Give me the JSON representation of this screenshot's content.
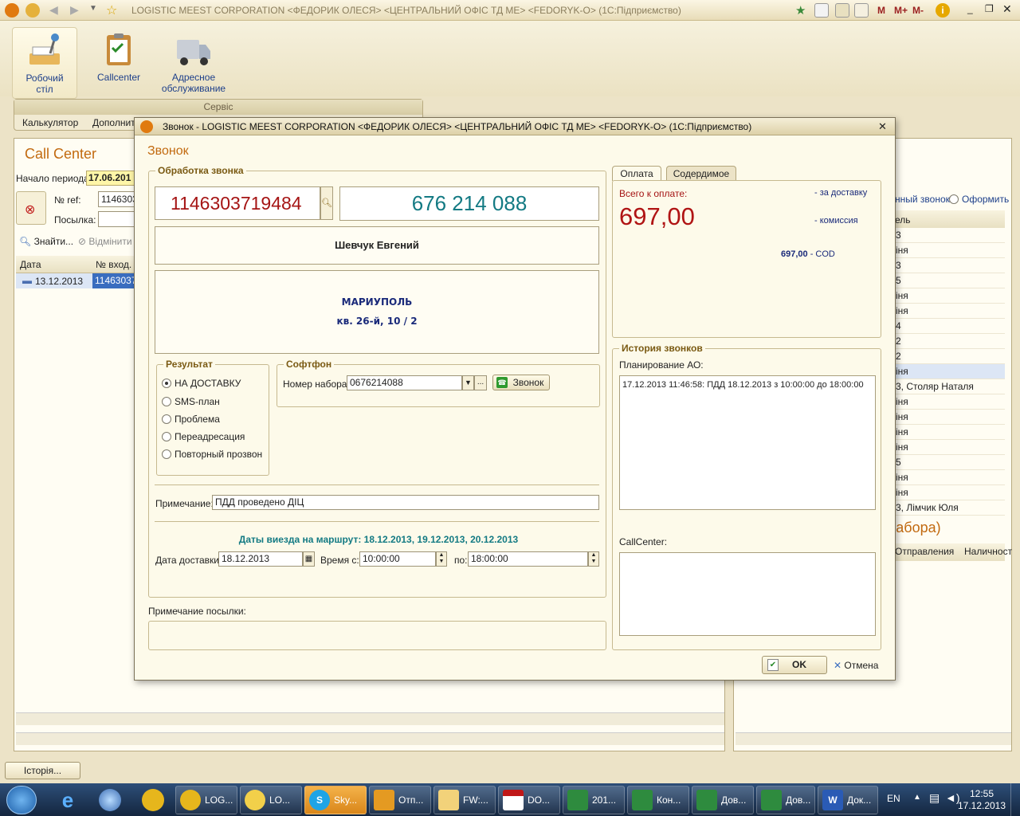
{
  "titlebar": {
    "title": "LOGISTIC MEEST CORPORATION    <ФЕДОРИК ОЛЕСЯ>  <ЦЕНТРАЛЬНИЙ ОФІС ТД МЕ>  <FEDORYK-O>  (1С:Підприємство)",
    "m": "M",
    "mplus": "M+",
    "mminus": "M-"
  },
  "toolbar": {
    "items": [
      {
        "label_line1": "Робочий",
        "label_line2": "стіл"
      },
      {
        "label_line1": "Callcenter",
        "label_line2": ""
      },
      {
        "label_line1": "Адресное",
        "label_line2": "обслуживание"
      }
    ],
    "service_header": "Сервіс",
    "service_items": [
      "Калькулятор",
      "Дополнитe"
    ]
  },
  "callcenter": {
    "title": "Call Center",
    "period_label": "Начало периода:",
    "period_value": "17.06.201",
    "ref_label": "№ ref:",
    "ref_value": "1146303",
    "parcel_label": "Посылка:",
    "find_label": "Знайти...",
    "cancel_label": "Відмінити",
    "columns": [
      "Дата",
      "№ вход."
    ],
    "row": {
      "date": "13.12.2013",
      "num": "11463037"
    }
  },
  "right_panel": {
    "radio_label": "нный звонок",
    "radio2_label": "Оформить",
    "col_header": "ель",
    "rows": [
      "3",
      "іня",
      "3",
      "5",
      "іня",
      "іня",
      "4",
      "2",
      "2",
      "іня",
      "3, Столяр Наталя",
      "іня",
      "іня",
      "іня",
      "іня",
      "5",
      "іня",
      "іня",
      "3, Лімчик Юля"
    ],
    "lower_title": "забора)",
    "lower_col1": "Отправления",
    "lower_col2": "Наличност"
  },
  "dialog": {
    "title": "Звонок - LOGISTIC MEEST CORPORATION    <ФЕДОРИК ОЛЕСЯ>  <ЦЕНТРАЛЬНИЙ ОФІС ТД МЕ>  <FEDORYK-O>  (1С:Підприємство)",
    "heading": "Звонок",
    "processing_title": "Обработка звонка",
    "ref_number": "1146303719484",
    "phone_display": "676 214 088",
    "customer_name": "Шевчук Евгений",
    "city": "МАРИУПОЛЬ",
    "address": "кв. 26-й, 10 / 2",
    "result_title": "Результат",
    "results": [
      "НА ДОСТАВКУ",
      "SMS-план",
      "Проблема",
      "Переадресация",
      "Повторный прозвон"
    ],
    "softphone_title": "Софтфон",
    "dial_label": "Номер набора:",
    "dial_value": "0676214088",
    "call_button": "Звонок",
    "note_label": "Примечание:",
    "note_value": "ПДД проведено ДІЦ",
    "route_dates": "Даты виезда на маршрут: 18.12.2013, 19.12.2013, 20.12.2013",
    "delivery_date_label": "Дата доставки:",
    "delivery_date_value": "18.12.2013",
    "time_from_label": "Время с:",
    "time_from_value": "10:00:00",
    "time_to_label": "по:",
    "time_to_value": "18:00:00",
    "parcel_note_label": "Примечание посылки:",
    "tabs": [
      "Оплата",
      "Содердимое"
    ],
    "total_label": "Всего к оплате:",
    "total_value": "697,00",
    "delivery_fee_label": "- за доставку",
    "commission_label": "- комиссия",
    "cod_value": "697,00",
    "cod_label": " - COD",
    "history_title": "История звонков",
    "planning_label": "Планирование АО:",
    "planning_text": "17.12.2013 11:46:58: ПДД 18.12.2013 з 10:00:00 до 18:00:00",
    "callcenter_label": "CallCenter:",
    "ok_button": "OK",
    "cancel_button": "Отмена"
  },
  "history_button": "Історія...",
  "taskbar": {
    "tasks": [
      "LOG...",
      "LO...",
      "Sky...",
      "Отп...",
      "FW:...",
      "DO...",
      "201...",
      "Кон...",
      "Дов...",
      "Дов...",
      "Док..."
    ],
    "lang": "EN",
    "time": "12:55",
    "date": "17.12.2013"
  },
  "colors": {
    "accent_red": "#b01414",
    "accent_teal": "#137a83",
    "title_brown": "#7a5a13"
  }
}
